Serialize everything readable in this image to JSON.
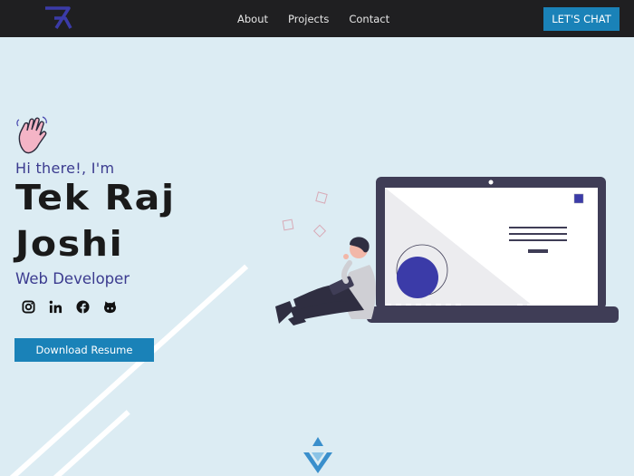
{
  "nav": {
    "logo": "tek-raj-logo",
    "links": [
      "About",
      "Projects",
      "Contact"
    ],
    "cta_label": "LET'S CHAT"
  },
  "hero": {
    "greeting": "Hi there!, I'm",
    "name_line1": "Tek Raj",
    "name_line2": "Joshi",
    "role": "Web Developer",
    "socials": [
      "instagram-icon",
      "linkedin-icon",
      "facebook-icon",
      "github-icon"
    ],
    "resume_label": "Download Resume"
  },
  "colors": {
    "nav_bg": "#1f1f21",
    "page_bg": "#dcecf3",
    "accent": "#1a82b8",
    "indigo": "#3b3b8f",
    "name_text": "#1a1a1a"
  },
  "illustration": "person-with-laptop",
  "scroll_icon": "chevron-down-icon"
}
